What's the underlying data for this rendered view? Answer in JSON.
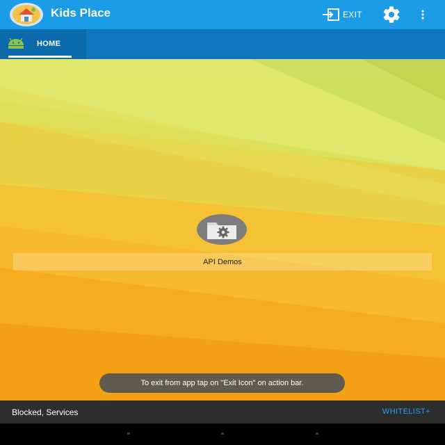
{
  "app": {
    "title": "Kids Place"
  },
  "action_bar": {
    "exit_label": "EXIT",
    "exit_icon": "exit-icon",
    "settings_icon": "gear-icon",
    "overflow_icon": "overflow-menu-icon"
  },
  "tabs": [
    {
      "label": "HOME",
      "icon": "android-icon",
      "selected": true
    }
  ],
  "home": {
    "apps": [
      {
        "label": "API Demos",
        "icon": "folder-gear-icon"
      }
    ]
  },
  "toast": {
    "text": "To exit from app tap on \"Exit Icon\" on action bar."
  },
  "bottom_bar": {
    "status": "Blocked, Services",
    "whitelist_label": "WHITELIST+"
  },
  "colors": {
    "action_bar": "#1b9ce6",
    "tab_bar": "#0d78bf",
    "accent": "#1ea5f0"
  }
}
